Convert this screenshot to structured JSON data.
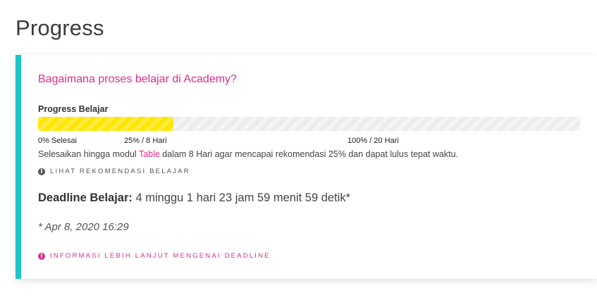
{
  "page": {
    "title": "Progress"
  },
  "card": {
    "accent_color": "#1ec5c9",
    "question": "Bagaimana proses belajar di Academy?",
    "progress": {
      "label": "Progress Belajar",
      "fill_percent": 25,
      "fill_color": "#ffe600",
      "markers": {
        "start": "0% Selesai",
        "recommended": "25% / 8 Hari",
        "end": "100% / 20 Hari"
      }
    },
    "hint": {
      "before": "Selesaikan hingga modul ",
      "module": "Table",
      "after": " dalam 8 Hari agar mencapai rekomendasi 25% dan dapat lulus tepat waktu."
    },
    "recommendation_link": {
      "icon": "info-icon",
      "label": "LIHAT REKOMENDASI BELAJAR"
    },
    "deadline": {
      "label": "Deadline Belajar:",
      "value": " 4 minggu 1 hari 23 jam 59 menit 59 detik*",
      "date": "* Apr 8, 2020 16:29"
    },
    "deadline_link": {
      "icon": "info-icon",
      "label": "INFORMASI LEBIH LANJUT MENGENAI DEADLINE",
      "color": "#e12b8c"
    }
  }
}
